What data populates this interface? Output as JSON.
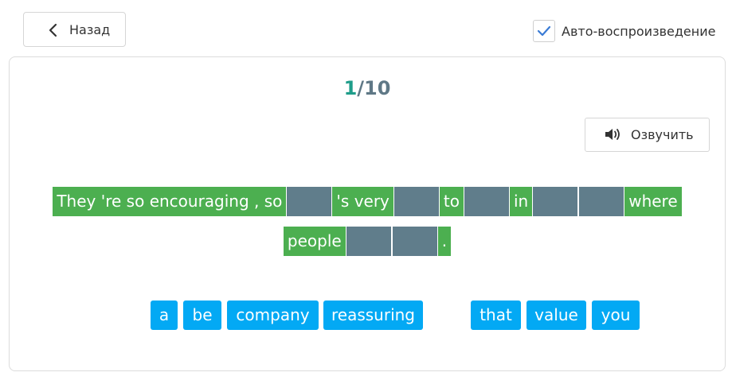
{
  "header": {
    "back_label": "Назад",
    "autoplay_label": "Авто-воспроизведение",
    "autoplay_checked": true
  },
  "exercise": {
    "progress_current": "1",
    "progress_total": "/10",
    "speak_label": "Озвучить",
    "sentence_segments": [
      "They 're so encouraging , so",
      "'s very",
      "to",
      "in",
      "where",
      "people",
      "."
    ],
    "word_bank": [
      "a",
      "be",
      "company",
      "reassuring",
      "that",
      "value",
      "you"
    ]
  },
  "colors": {
    "filled_segment": "#4caf50",
    "blank_slot": "#607d8b",
    "word_chip": "#03a9f4",
    "progress_current": "#1f9d8a",
    "progress_total": "#5f7886",
    "checkbox_tick": "#3a7bd5"
  },
  "icons": {
    "back": "chevron-left-icon",
    "autoplay_check": "check-icon",
    "speak": "speaker-icon"
  }
}
